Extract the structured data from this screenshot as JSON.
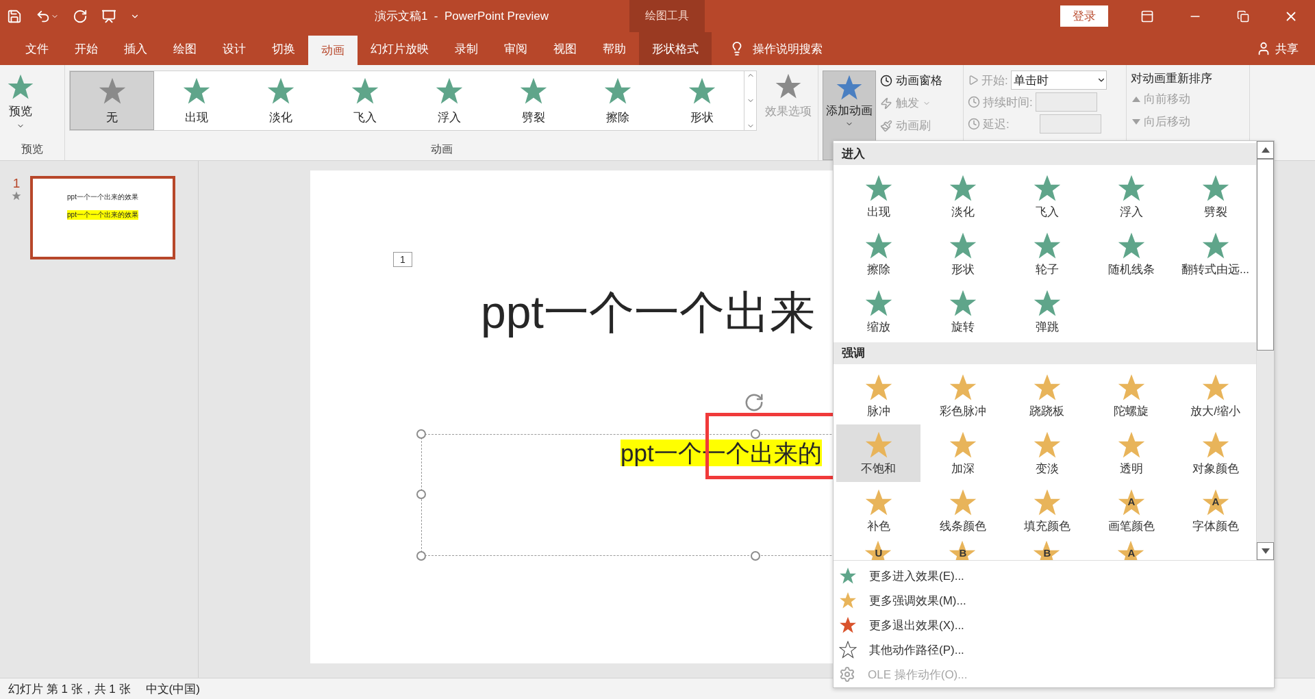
{
  "title_bar": {
    "title": "演示文稿1  -  PowerPoint Preview",
    "context_tab": "绘图工具",
    "login": "登录"
  },
  "tabs": [
    {
      "label": "文件",
      "selected": false,
      "kind": "normal"
    },
    {
      "label": "开始",
      "selected": false,
      "kind": "normal"
    },
    {
      "label": "插入",
      "selected": false,
      "kind": "normal"
    },
    {
      "label": "绘图",
      "selected": false,
      "kind": "normal"
    },
    {
      "label": "设计",
      "selected": false,
      "kind": "normal"
    },
    {
      "label": "切换",
      "selected": false,
      "kind": "normal"
    },
    {
      "label": "动画",
      "selected": true,
      "kind": "normal"
    },
    {
      "label": "幻灯片放映",
      "selected": false,
      "kind": "normal"
    },
    {
      "label": "录制",
      "selected": false,
      "kind": "normal"
    },
    {
      "label": "审阅",
      "selected": false,
      "kind": "normal"
    },
    {
      "label": "视图",
      "selected": false,
      "kind": "normal"
    },
    {
      "label": "帮助",
      "selected": false,
      "kind": "normal"
    },
    {
      "label": "形状格式",
      "selected": false,
      "kind": "context"
    }
  ],
  "tell_me": "操作说明搜索",
  "share": "共享",
  "ribbon": {
    "preview": {
      "button": "预览",
      "group": "预览"
    },
    "gallery": {
      "group": "动画",
      "effect_options": "效果选项",
      "items": [
        {
          "label": "无",
          "selected": true,
          "kind": "none"
        },
        {
          "label": "出现",
          "selected": false,
          "kind": "entrance"
        },
        {
          "label": "淡化",
          "selected": false,
          "kind": "entrance"
        },
        {
          "label": "飞入",
          "selected": false,
          "kind": "entrance"
        },
        {
          "label": "浮入",
          "selected": false,
          "kind": "entrance"
        },
        {
          "label": "劈裂",
          "selected": false,
          "kind": "entrance"
        },
        {
          "label": "擦除",
          "selected": false,
          "kind": "entrance"
        },
        {
          "label": "形状",
          "selected": false,
          "kind": "entrance"
        }
      ]
    },
    "advanced": {
      "add": "添加动画",
      "pane": "动画窗格",
      "trigger": "触发",
      "painter": "动画刷"
    },
    "timing": {
      "start_label": "开始:",
      "start_value": "单击时",
      "duration_label": "持续时间:",
      "delay_label": "延迟:"
    },
    "reorder": {
      "title": "对动画重新排序",
      "earlier": "向前移动",
      "later": "向后移动"
    }
  },
  "slides_pane": {
    "number": "1",
    "selected": true,
    "thumb_title": "ppt一个一个出来的效果",
    "thumb_body": "ppt一个一个出来的效果"
  },
  "slide": {
    "anim_tag": "1",
    "title": "ppt一个一个出来",
    "body": "ppt一个一个出来的"
  },
  "dropdown": {
    "sections": [
      {
        "title": "进入",
        "kind": "entrance",
        "items": [
          {
            "label": "出现",
            "selected": false
          },
          {
            "label": "淡化",
            "selected": false
          },
          {
            "label": "飞入",
            "selected": false
          },
          {
            "label": "浮入",
            "selected": false
          },
          {
            "label": "劈裂",
            "selected": false
          },
          {
            "label": "擦除",
            "selected": false
          },
          {
            "label": "形状",
            "selected": false
          },
          {
            "label": "轮子",
            "selected": false
          },
          {
            "label": "随机线条",
            "selected": false
          },
          {
            "label": "翻转式由远...",
            "selected": false
          },
          {
            "label": "缩放",
            "selected": false
          },
          {
            "label": "旋转",
            "selected": false
          },
          {
            "label": "弹跳",
            "selected": false
          }
        ]
      },
      {
        "title": "强调",
        "kind": "emphasis",
        "items": [
          {
            "label": "脉冲",
            "selected": false
          },
          {
            "label": "彩色脉冲",
            "selected": false
          },
          {
            "label": "跷跷板",
            "selected": false
          },
          {
            "label": "陀螺旋",
            "selected": false
          },
          {
            "label": "放大/缩小",
            "selected": false
          },
          {
            "label": "不饱和",
            "selected": true
          },
          {
            "label": "加深",
            "selected": false
          },
          {
            "label": "变淡",
            "selected": false
          },
          {
            "label": "透明",
            "selected": false
          },
          {
            "label": "对象颜色",
            "selected": false
          },
          {
            "label": "补色",
            "selected": false
          },
          {
            "label": "线条颜色",
            "selected": false
          },
          {
            "label": "填充颜色",
            "selected": false
          },
          {
            "label": "画笔颜色",
            "selected": false,
            "glyph": "A"
          },
          {
            "label": "字体颜色",
            "selected": false,
            "glyph": "A"
          }
        ],
        "cut_row": [
          {
            "glyph": "U"
          },
          {
            "glyph": "B"
          },
          {
            "glyph": "B"
          },
          {
            "glyph": "A"
          }
        ]
      }
    ],
    "more": [
      {
        "label": "更多进入效果(E)...",
        "kind": "entrance",
        "disabled": false
      },
      {
        "label": "更多强调效果(M)...",
        "kind": "emphasis",
        "disabled": false
      },
      {
        "label": "更多退出效果(X)...",
        "kind": "exit",
        "disabled": false
      },
      {
        "label": "其他动作路径(P)...",
        "kind": "path",
        "disabled": false
      },
      {
        "label": "OLE 操作动作(O)...",
        "kind": "ole",
        "disabled": true
      }
    ]
  },
  "status_bar": {
    "slide_info": "幻灯片 第 1 张，共 1 张",
    "language": "中文(中国)"
  }
}
